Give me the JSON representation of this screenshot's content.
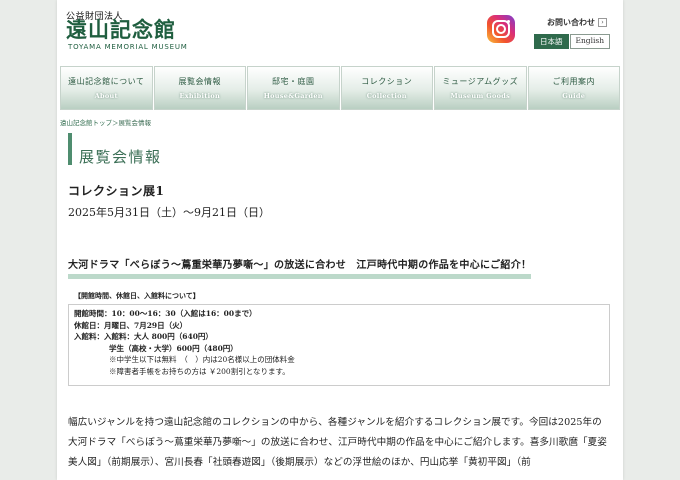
{
  "header": {
    "corp_label": "公益財団法人",
    "logo_jp": "遠山記念館",
    "logo_en": "TOYAMA MEMORIAL MUSEUM",
    "contact_label": "お問い合わせ",
    "lang_ja": "日本語",
    "lang_en": "English"
  },
  "nav": [
    {
      "jp": "遠山記念館について",
      "en": "About"
    },
    {
      "jp": "展覧会情報",
      "en": "Exhibition"
    },
    {
      "jp": "邸宅・庭園",
      "en": "House&Garden"
    },
    {
      "jp": "コレクション",
      "en": "Collection"
    },
    {
      "jp": "ミュージアムグッズ",
      "en": "Museum Goods"
    },
    {
      "jp": "ご利用案内",
      "en": "Guide"
    }
  ],
  "breadcrumb": {
    "home": "遠山記念館トップ",
    "sep": "＞",
    "current": "展覧会情報"
  },
  "page_title": "展覧会情報",
  "exhibition": {
    "name": "コレクション展1",
    "date": "2025年5月31日（土）〜9月21日（日）",
    "lead": "大河ドラマ「べらぼう～蔦重栄華乃夢噺～」の放送に合わせ　江戸時代中期の作品を中心にご紹介！"
  },
  "info": {
    "label": "【開館時間、休館日、入館料について】",
    "lines": [
      "開館時間：10：00～16：30（入館は16：00まで）",
      "休館日：月曜日、7月29日（火）",
      "入館料：入館料：大人 800円（640円）",
      "学生（高校・大学）600円（480円）",
      "※中学生以下は無料　（　）内は20名様以上の団体料金",
      "※障害者手帳をお持ちの方は ￥200割引となります。"
    ]
  },
  "body": {
    "text": "幅広いジャンルを持つ遠山記念館のコレクションの中から、各種ジャンルを紹介するコレクション展です。今回は2025年の大河ドラマ「べらぼう～蔦重栄華乃夢噺～」の放送に合わせ、江戸時代中期の作品を中心にご紹介します。喜多川歌麿「夏姿美人図」（前期展示）、宮川長春「社頭春遊図」（後期展示）などの浮世絵のほか、円山応挙「黄初平図」（前"
  }
}
